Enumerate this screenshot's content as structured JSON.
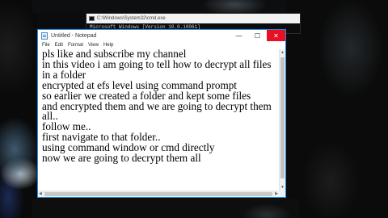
{
  "cmd": {
    "title": "C:\\Windows\\System32\\cmd.exe",
    "line": "Microsoft Windows [Version 10.0.10061]"
  },
  "notepad": {
    "title": "Untitled - Notepad",
    "controls": {
      "minimize": "—",
      "maximize": "☐",
      "close": "✕"
    },
    "menu": [
      "File",
      "Edit",
      "Format",
      "View",
      "Help"
    ],
    "lines": [
      "pls like and subscribe my channel",
      "in this video i am going to tell how to decrypt all files",
      "in a folder",
      "encrypted at efs level using command prompt",
      "so earlier we created a folder and kept some files",
      "and encrypted them and we are going to decrypt them",
      "all..",
      "follow me..",
      "first navigate to that folder..",
      "using command window or cmd directly",
      "now we are going to decrypt them all"
    ]
  },
  "icons": {
    "cmd": "cmd-icon",
    "notepad": "notepad-icon",
    "scroll_up": "chevron-up-icon",
    "scroll_down": "chevron-down-icon",
    "scroll_left": "chevron-left-icon",
    "scroll_right": "chevron-right-icon"
  },
  "colors": {
    "close_button": "#e81123",
    "window_border": "#1d8fe6",
    "background": "#0b0c0d"
  }
}
